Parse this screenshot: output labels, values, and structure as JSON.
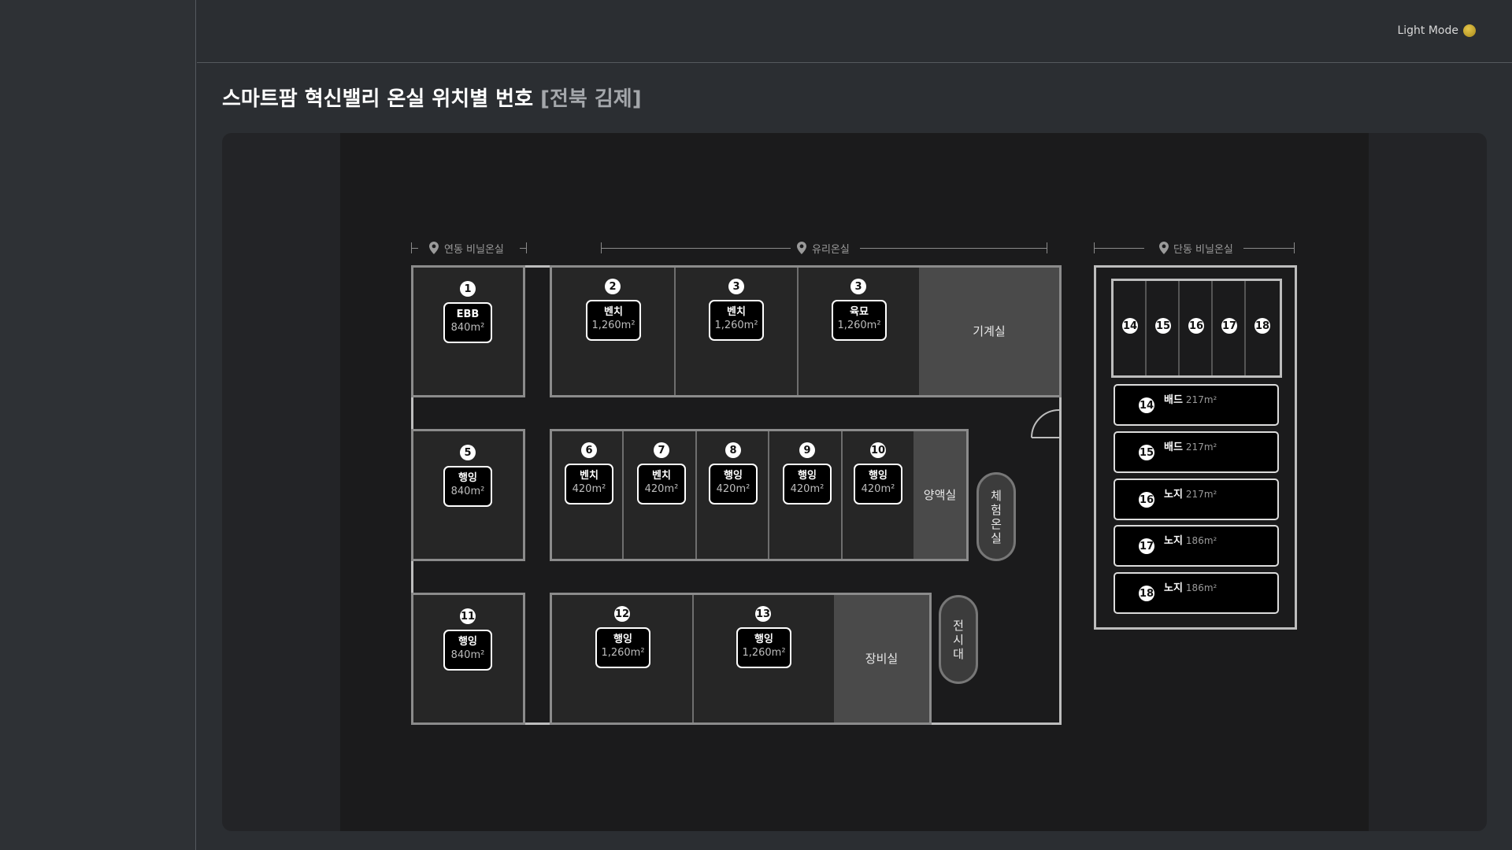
{
  "header": {
    "mode_label": "Light Mode",
    "title": "스마트팜 혁신밸리 온실 위치별 번호",
    "region": "[전북 김제]"
  },
  "colors": {
    "accent": "#c9a82a",
    "background": "#2b2e32",
    "canvas": "#1b1b1c",
    "box": "#000000"
  },
  "icons": {
    "location": "map-pin-icon",
    "door": "door-swing-icon"
  },
  "sections": {
    "yeondong": "연동 비닐온실",
    "glass": "유리온실",
    "dandong": "단동 비닐온실"
  },
  "greenhouses": {
    "g1": {
      "num": "1",
      "type": "EBB",
      "area": "840m²"
    },
    "g2": {
      "num": "2",
      "type": "벤치",
      "area": "1,260m²"
    },
    "g3a": {
      "num": "3",
      "type": "벤치",
      "area": "1,260m²"
    },
    "g3b": {
      "num": "3",
      "type": "육묘",
      "area": "1,260m²"
    },
    "g5": {
      "num": "5",
      "type": "행잉",
      "area": "840m²"
    },
    "g6": {
      "num": "6",
      "type": "벤치",
      "area": "420m²"
    },
    "g7": {
      "num": "7",
      "type": "벤치",
      "area": "420m²"
    },
    "g8": {
      "num": "8",
      "type": "행잉",
      "area": "420m²"
    },
    "g9": {
      "num": "9",
      "type": "행잉",
      "area": "420m²"
    },
    "g10": {
      "num": "10",
      "type": "행잉",
      "area": "420m²"
    },
    "g11": {
      "num": "11",
      "type": "행잉",
      "area": "840m²"
    },
    "g12": {
      "num": "12",
      "type": "행잉",
      "area": "1,260m²"
    },
    "g13": {
      "num": "13",
      "type": "행잉",
      "area": "1,260m²"
    }
  },
  "rooms": {
    "machine": "기계실",
    "nutrient": "양액실",
    "experience": "체험온실",
    "display": "전시대",
    "equipment": "장비실"
  },
  "dandong": {
    "strips": [
      "14",
      "15",
      "16",
      "17",
      "18"
    ],
    "beds": [
      {
        "num": "14",
        "type": "배드",
        "area": "217m²"
      },
      {
        "num": "15",
        "type": "배드",
        "area": "217m²"
      },
      {
        "num": "16",
        "type": "노지",
        "area": "217m²"
      },
      {
        "num": "17",
        "type": "노지",
        "area": "186m²"
      },
      {
        "num": "18",
        "type": "노지",
        "area": "186m²"
      }
    ]
  }
}
